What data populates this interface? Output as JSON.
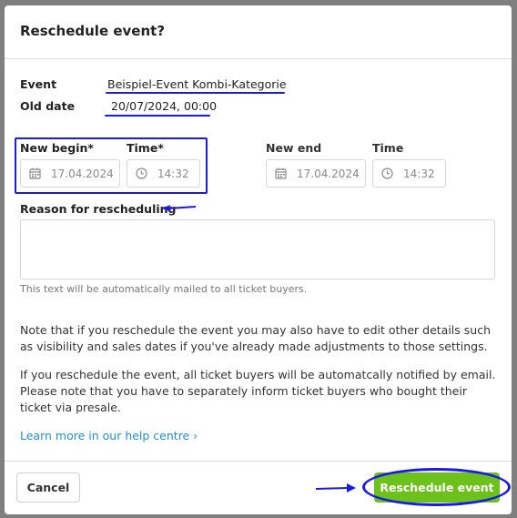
{
  "dialog": {
    "title": "Reschedule event?"
  },
  "event_info": {
    "event_label": "Event",
    "event_value": "Beispiel-Event Kombi-Kategorie",
    "old_date_label": "Old date",
    "old_date_value": "20/07/2024, 00:00"
  },
  "new_schedule": {
    "begin_label": "New begin*",
    "begin_time_label": "Time*",
    "begin_date": "17.04.2024",
    "begin_time": "14:32",
    "end_label": "New end",
    "end_time_label": "Time",
    "end_date": "17.04.2024",
    "end_time": "14:32"
  },
  "reason": {
    "label": "Reason for rescheduling",
    "value": "",
    "hint": "This text will be automatically mailed to all ticket buyers."
  },
  "notes": {
    "para1": "Note that if you reschedule the event you may also have to edit other details such as visibility and sales dates if you've already made adjustments to those settings.",
    "para2": "If you reschedule the event, all ticket buyers will be automatcally notified by email. Please note that you have to separately inform ticket buyers who bought their ticket via presale.",
    "help_link": "Learn more in our help centre",
    "help_chevron": "›"
  },
  "footer": {
    "cancel_label": "Cancel",
    "submit_label": "Reschedule event"
  },
  "colors": {
    "annotation": "#1a1ae6",
    "primary": "#6cc21a",
    "link": "#1e90d8"
  },
  "icons": {
    "date": "calendar-icon",
    "time": "clock-icon"
  }
}
